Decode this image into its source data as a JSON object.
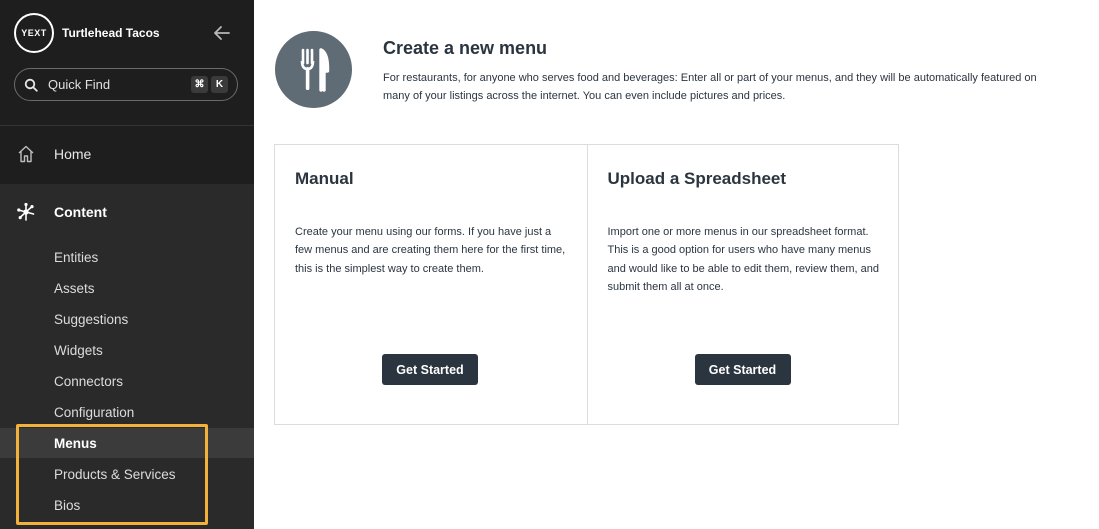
{
  "sidebar": {
    "logo_text": "YEXT",
    "brand_name": "Turtlehead Tacos",
    "search": {
      "placeholder": "Quick Find",
      "shortcut_keys": [
        "⌘",
        "K"
      ]
    },
    "home_label": "Home",
    "content_label": "Content",
    "content_items": [
      {
        "label": "Entities"
      },
      {
        "label": "Assets"
      },
      {
        "label": "Suggestions"
      },
      {
        "label": "Widgets"
      },
      {
        "label": "Connectors"
      },
      {
        "label": "Configuration"
      },
      {
        "label": "Menus",
        "active": true
      },
      {
        "label": "Products & Services"
      },
      {
        "label": "Bios"
      }
    ],
    "highlight_color": "#f2b13b"
  },
  "main": {
    "title": "Create a new menu",
    "description": "For restaurants, for anyone who serves food and beverages: Enter all or part of your menus, and they will be automatically featured on many of your listings across the internet. You can even include pictures and prices.",
    "hero_icon": "fork-knife-icon",
    "cards": [
      {
        "title": "Manual",
        "text": "Create your menu using our forms. If you have just a few menus and are creating them here for the first time, this is the simplest way to create them.",
        "button_label": "Get Started"
      },
      {
        "title": "Upload a Spreadsheet",
        "text": "Import one or more menus in our spreadsheet format. This is a good option for users who have many menus and would like to be able to edit them, review them, and submit them all at once.",
        "button_label": "Get Started"
      }
    ]
  },
  "colors": {
    "sidebar_bg": "#1e1e1e",
    "content_section_bg": "#2a2a2a",
    "active_item_bg": "#3b3b3b",
    "accent_dark": "#2b3540",
    "hero_icon_bg": "#5f6b75"
  }
}
